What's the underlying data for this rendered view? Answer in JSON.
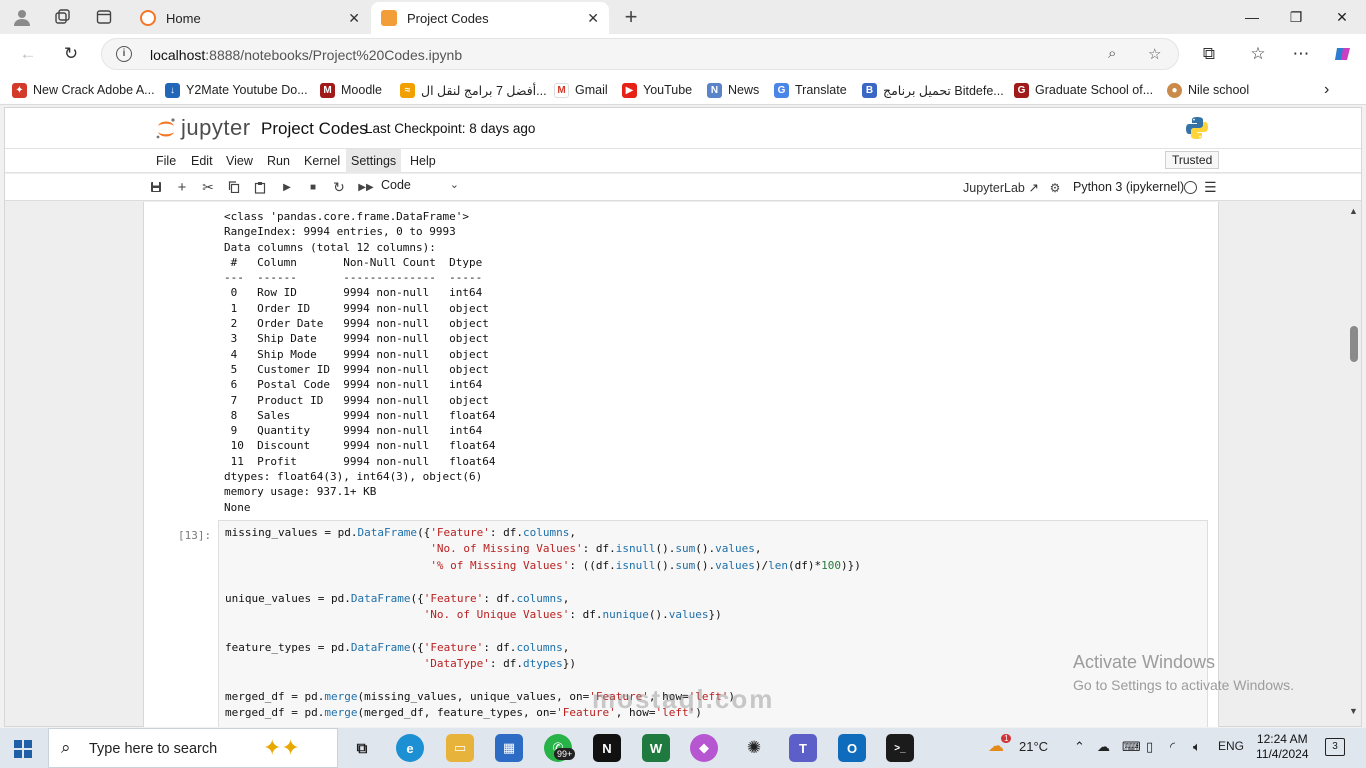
{
  "browser": {
    "tabs": [
      {
        "label": "Home",
        "active": false
      },
      {
        "label": "Project Codes",
        "active": true
      }
    ],
    "url_host": "localhost",
    "url_rest": ":8888/notebooks/Project%20Codes.ipynb"
  },
  "bookmarks": [
    "New Crack Adobe A...",
    "Y2Mate Youtube Do...",
    "Moodle",
    "أفضل 7 برامج لنقل ال...",
    "Gmail",
    "YouTube",
    "News",
    "Translate",
    "تحميل برنامج Bitdefe...",
    "Graduate School of...",
    "Nile school"
  ],
  "jupyter": {
    "logo_text": "jupyter",
    "notebook_title": "Project Codes",
    "checkpoint": "Last Checkpoint: 8 days ago",
    "menu": [
      "File",
      "Edit",
      "View",
      "Run",
      "Kernel",
      "Settings",
      "Help"
    ],
    "active_menu": "Settings",
    "trusted": "Trusted",
    "cell_type": "Code",
    "jupyterlab_link": "JupyterLab",
    "kernel": "Python 3 (ipykernel)"
  },
  "output_lines": [
    "<class 'pandas.core.frame.DataFrame'>",
    "RangeIndex: 9994 entries, 0 to 9993",
    "Data columns (total 12 columns):",
    " #   Column       Non-Null Count  Dtype  ",
    "---  ------       --------------  -----  ",
    " 0   Row ID       9994 non-null   int64  ",
    " 1   Order ID     9994 non-null   object ",
    " 2   Order Date   9994 non-null   object ",
    " 3   Ship Date    9994 non-null   object ",
    " 4   Ship Mode    9994 non-null   object ",
    " 5   Customer ID  9994 non-null   object ",
    " 6   Postal Code  9994 non-null   int64  ",
    " 7   Product ID   9994 non-null   object ",
    " 8   Sales        9994 non-null   float64",
    " 9   Quantity     9994 non-null   int64  ",
    " 10  Discount     9994 non-null   float64",
    " 11  Profit       9994 non-null   float64",
    "dtypes: float64(3), int64(3), object(6)",
    "memory usage: 937.1+ KB",
    "None"
  ],
  "cell_prompt": "[13]:",
  "code_lines": [
    "missing_values = pd.DataFrame({'Feature': df.columns,",
    "                               'No. of Missing Values': df.isnull().sum().values,",
    "                               '% of Missing Values': ((df.isnull().sum().values)/len(df)*100)})",
    "",
    "unique_values = pd.DataFrame({'Feature': df.columns,",
    "                              'No. of Unique Values': df.nunique().values})",
    "",
    "feature_types = pd.DataFrame({'Feature': df.columns,",
    "                              'DataType': df.dtypes})",
    "",
    "merged_df = pd.merge(missing_values, unique_values, on='Feature', how='left')",
    "merged_df = pd.merge(merged_df, feature_types, on='Feature', how='left')"
  ],
  "activate": {
    "line1": "Activate Windows",
    "line2": "Go to Settings to activate Windows."
  },
  "watermark": "mostaql.com",
  "taskbar": {
    "search_placeholder": "Type here to search",
    "whatsapp_badge": "99+",
    "weather_badge": "1",
    "temperature": "21°C",
    "language": "ENG",
    "time": "12:24 AM",
    "date": "11/4/2024",
    "notifications": "3"
  }
}
